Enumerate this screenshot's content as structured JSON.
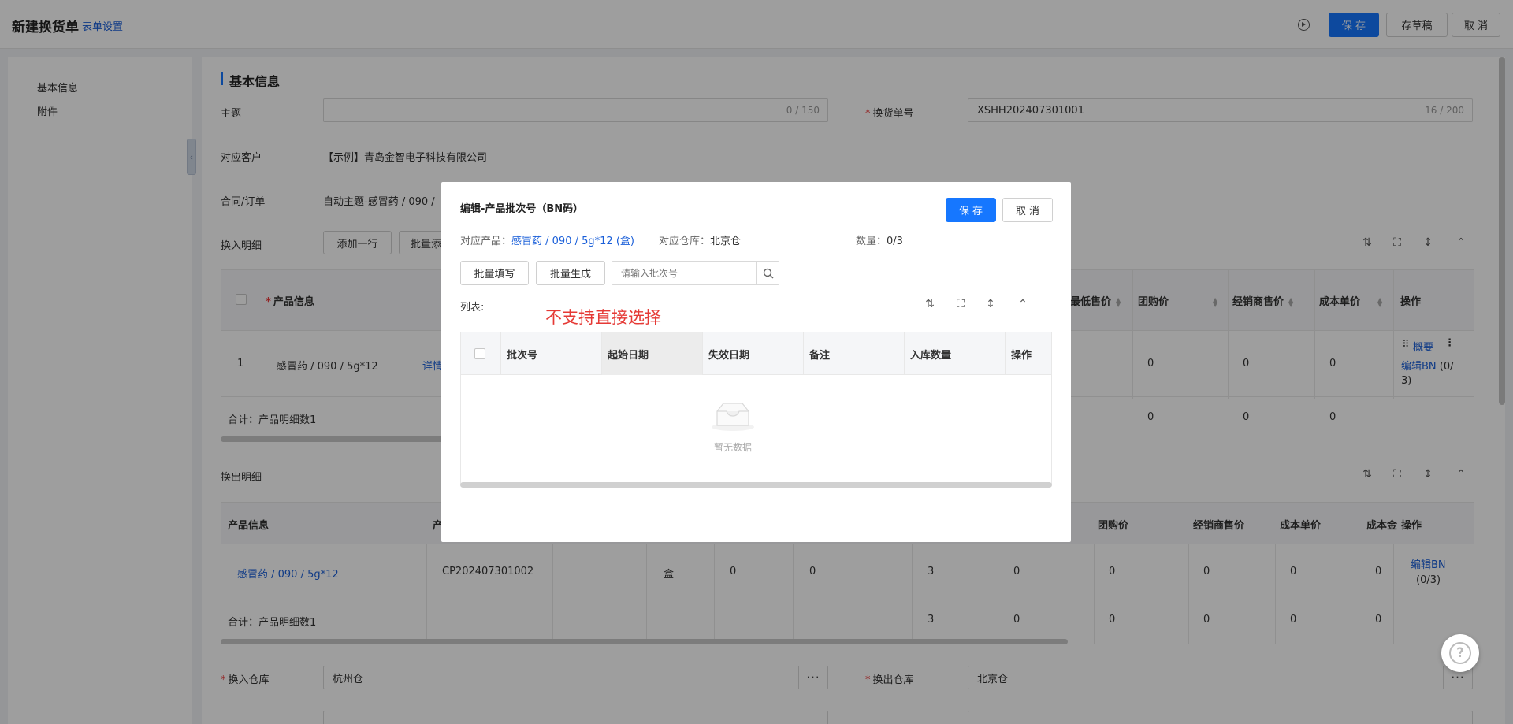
{
  "header": {
    "title": "新建换货单",
    "form_setting": "表单设置",
    "save": "保 存",
    "draft": "存草稿",
    "cancel": "取 消"
  },
  "sidebar": {
    "items": [
      {
        "label": "基本信息"
      },
      {
        "label": "附件"
      }
    ]
  },
  "basic": {
    "section_title": "基本信息",
    "subject_label": "主题",
    "subject_value": "",
    "subject_counter": "0 / 150",
    "exchange_no_label": "换货单号",
    "exchange_no_value": "XSHH202407301001",
    "exchange_no_counter": "16 / 200",
    "customer_label": "对应客户",
    "customer_value": "【示例】青岛金智电子科技有限公司",
    "contract_label": "合同/订单",
    "contract_value": "自动主题-感冒药 / 090 /"
  },
  "in_detail": {
    "label": "换入明细",
    "add_row": "添加一行",
    "batch_add": "批量添",
    "headers": {
      "product": "产品信息",
      "min_price": "最低售价",
      "group_price": "团购价",
      "dealer_price": "经销商售价",
      "cost": "成本单价",
      "action": "操作"
    },
    "row": {
      "index": "1",
      "product": "感冒药 / 090 / 5g*12",
      "detail": "详情",
      "group_price": "0",
      "dealer_price": "0",
      "cost": "0",
      "summary_link": "概要",
      "edit_bn": "编辑BN",
      "edit_bn_count": "(0/",
      "edit_bn_count2": "3)"
    },
    "total_label": "合计：产品明细数1",
    "total_values": [
      "0",
      "0",
      "0"
    ]
  },
  "out_detail": {
    "label": "换出明细",
    "headers": {
      "product": "产品信息",
      "product_code": "产",
      "group_price": "团购价",
      "dealer_price": "经销商售价",
      "cost": "成本单价",
      "cost2": "成本金",
      "action": "操作"
    },
    "row": {
      "product": "感冒药 / 090 / 5g*12",
      "code": "CP202407301002",
      "unit": "盒",
      "v1": "0",
      "v2": "0",
      "qty": "3",
      "v3": "0",
      "group_price": "0",
      "dealer_price": "0",
      "cost": "0",
      "cost2": "0",
      "edit_bn": "编辑BN",
      "edit_bn_count": "(0/3)"
    },
    "total_label": "合计：产品明细数1",
    "total_values": [
      "3",
      "0",
      "0",
      "0",
      "0",
      "0"
    ]
  },
  "warehouse": {
    "in_label": "换入仓库",
    "in_value": "杭州仓",
    "out_label": "换出仓库",
    "out_value": "北京仓"
  },
  "modal": {
    "title": "编辑-产品批次号（BN码）",
    "save": "保 存",
    "cancel": "取 消",
    "product_label": "对应产品：",
    "product_value": "感冒药 / 090 / 5g*12 (盒)",
    "warehouse_label": "对应仓库：",
    "warehouse_value": "北京仓",
    "qty_label": "数量：",
    "qty_value": "0/3",
    "batch_fill": "批量填写",
    "batch_generate": "批量生成",
    "search_placeholder": "请输入批次号",
    "list_label": "列表:",
    "note": "不支持直接选择",
    "columns": [
      "批次号",
      "起始日期",
      "失效日期",
      "备注",
      "入库数量",
      "操作"
    ],
    "empty_text": "暂无数据"
  },
  "colors": {
    "primary": "#1677ff",
    "link": "#1a5fd9",
    "note_red": "#e53935"
  }
}
